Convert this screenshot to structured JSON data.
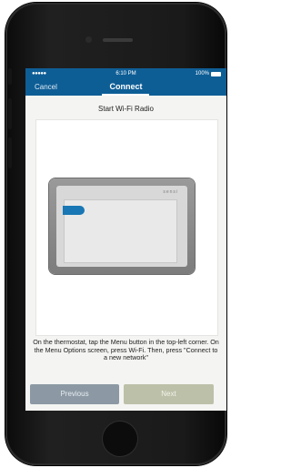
{
  "status_bar": {
    "signal": "●●●●●",
    "time": "6:10 PM",
    "battery": "100%",
    "battery_icon": "battery-icon"
  },
  "nav": {
    "cancel_label": "Cancel",
    "title": "Connect"
  },
  "step": {
    "title": "Start Wi-Fi Radio"
  },
  "illustration": {
    "brand_logo": "sensi"
  },
  "instructions": "On the thermostat, tap the Menu button in the top-left corner. On the Menu Options screen, press Wi-Fi. Then, press \"Connect to a new network\"",
  "buttons": {
    "previous_label": "Previous",
    "next_label": "Next"
  },
  "colors": {
    "header_blue": "#0e5e96",
    "menu_button_blue": "#1877b4",
    "previous_button": "#8c99a4",
    "next_button": "#bcc0a8"
  }
}
